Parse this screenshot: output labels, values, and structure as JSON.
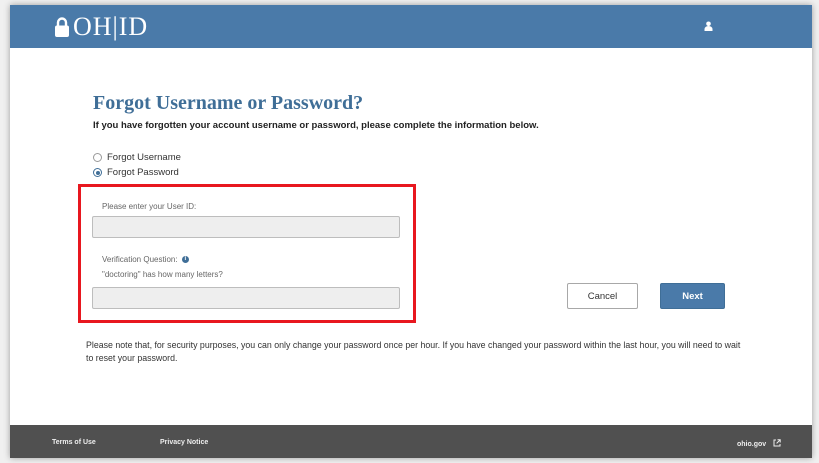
{
  "header": {
    "logo_text": "OH|ID",
    "user_icon": "user-icon"
  },
  "page": {
    "title": "Forgot Username or Password?",
    "subtitle": "If you have forgotten your account username or password, please complete the information below."
  },
  "options": [
    {
      "label": "Forgot Username",
      "selected": false
    },
    {
      "label": "Forgot Password",
      "selected": true
    }
  ],
  "form": {
    "user_id_label": "Please enter your User ID:",
    "user_id_value": "",
    "verification_label": "Verification Question:",
    "verification_question": "\"doctoring\" has how many letters?",
    "verification_value": ""
  },
  "buttons": {
    "cancel": "Cancel",
    "next": "Next"
  },
  "note": "Please note that, for security purposes, you can only change your password once per hour. If you have changed your password within the last hour, you will need to wait to reset your password.",
  "footer": {
    "terms": "Terms of Use",
    "privacy": "Privacy Notice",
    "ohio": "ohio.gov"
  },
  "colors": {
    "brand_blue": "#4a7aa9",
    "title_blue": "#3f6e97",
    "highlight_red": "#e8171f",
    "footer_gray": "#505050"
  }
}
